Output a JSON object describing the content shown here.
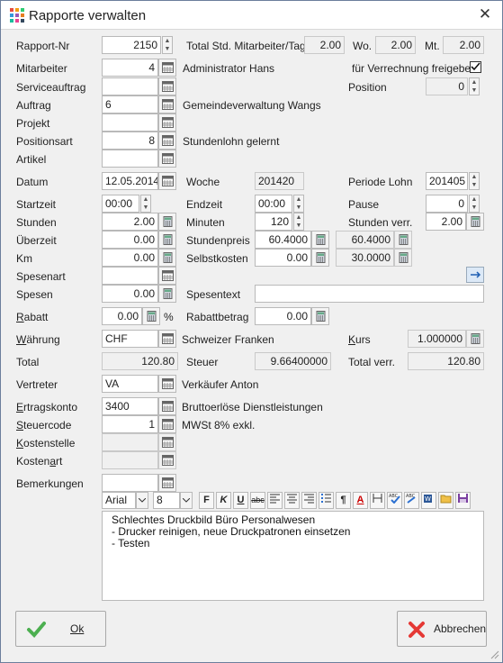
{
  "window": {
    "title": "Rapporte verwalten",
    "close_glyph": "✕"
  },
  "icon_colors": [
    "#e74c3c",
    "#f39c12",
    "#2ecc71",
    "#3498db",
    "#9b59b6",
    "#e67e22",
    "#1abc9c",
    "#e84393",
    "#34495e"
  ],
  "fields": {
    "rapport_nr": {
      "label": "Rapport-Nr",
      "value": "2150"
    },
    "total_std": {
      "label": "Total Std. Mitarbeiter/Tag",
      "value": "2.00"
    },
    "wo": {
      "label": "Wo.",
      "value": "2.00"
    },
    "mt": {
      "label": "Mt.",
      "value": "2.00"
    },
    "mitarbeiter": {
      "label": "Mitarbeiter",
      "value": "4",
      "desc": "Administrator Hans"
    },
    "verrechnung": {
      "label": "für Verrechnung freigeben",
      "checked": true
    },
    "serviceauftrag": {
      "label": "Serviceauftrag",
      "value": ""
    },
    "position": {
      "label": "Position",
      "value": "0"
    },
    "auftrag": {
      "label": "Auftrag",
      "value": "6",
      "desc": "Gemeindeverwaltung Wangs"
    },
    "projekt": {
      "label": "Projekt",
      "value": ""
    },
    "positionsart": {
      "label": "Positionsart",
      "value": "8",
      "desc": "Stundenlohn gelernt"
    },
    "artikel": {
      "label": "Artikel",
      "value": ""
    },
    "datum": {
      "label": "Datum",
      "value": "12.05.2014"
    },
    "woche": {
      "label": "Woche",
      "value": "201420"
    },
    "periode_lohn": {
      "label": "Periode Lohn",
      "value": "201405"
    },
    "startzeit": {
      "label": "Startzeit",
      "value": "00:00"
    },
    "endzeit": {
      "label": "Endzeit",
      "value": "00:00"
    },
    "pause": {
      "label": "Pause",
      "value": "0"
    },
    "stunden": {
      "label": "Stunden",
      "value": "2.00"
    },
    "minuten": {
      "label": "Minuten",
      "value": "120"
    },
    "stunden_verr": {
      "label": "Stunden verr.",
      "value": "2.00"
    },
    "ueberzeit": {
      "label": "Überzeit",
      "value": "0.00"
    },
    "stundenpreis": {
      "label": "Stundenpreis",
      "value": "60.4000",
      "value2": "60.4000"
    },
    "km": {
      "label": "Km",
      "value": "0.00"
    },
    "selbstkosten": {
      "label": "Selbstkosten",
      "value": "0.00",
      "value2": "30.0000"
    },
    "spesenart": {
      "label": "Spesenart",
      "value": ""
    },
    "spesen": {
      "label": "Spesen",
      "value": "0.00"
    },
    "spesentext": {
      "label": "Spesentext",
      "value": ""
    },
    "rabatt": {
      "label_u": "R",
      "label_rest": "abatt",
      "value": "0.00",
      "unit": "%"
    },
    "rabattbetrag": {
      "label": "Rabattbetrag",
      "value": "0.00"
    },
    "waehrung": {
      "label_u": "W",
      "label_rest": "ährung",
      "value": "CHF",
      "desc": "Schweizer Franken"
    },
    "kurs": {
      "label_u": "K",
      "label_rest": "urs",
      "value": "1.000000"
    },
    "total": {
      "label": "Total",
      "value": "120.80"
    },
    "steuer": {
      "label": "Steuer",
      "value": "9.66400000"
    },
    "total_verr": {
      "label": "Total verr.",
      "value": "120.80"
    },
    "vertreter": {
      "label": "Vertreter",
      "value": "VA",
      "desc": "Verkäufer Anton"
    },
    "ertragskonto": {
      "label_u": "E",
      "label_rest": "rtragskonto",
      "value": "3400",
      "desc": "Bruttoerlöse Dienstleistungen"
    },
    "steuercode": {
      "label_u": "S",
      "label_rest": "teuercode",
      "value": "1",
      "desc": "MWSt 8% exkl."
    },
    "kostenstelle": {
      "label_u": "K",
      "label_rest": "ostenstelle",
      "value": ""
    },
    "kostenart": {
      "label_pre": "Kosten",
      "label_u": "a",
      "label_rest": "rt",
      "value": ""
    },
    "bemerkungen": {
      "label": "Bemerkungen",
      "value": ""
    }
  },
  "editor": {
    "font": "Arial",
    "size": "8",
    "buttons": [
      "F",
      "K",
      "U",
      "abc",
      "¶",
      "A"
    ],
    "lines": [
      "Schlechtes Druckbild Büro Personalwesen",
      "- Drucker reinigen, neue Druckpatronen einsetzen",
      "- Testen"
    ]
  },
  "buttons": {
    "ok": "Ok",
    "cancel": "Abbrechen"
  }
}
